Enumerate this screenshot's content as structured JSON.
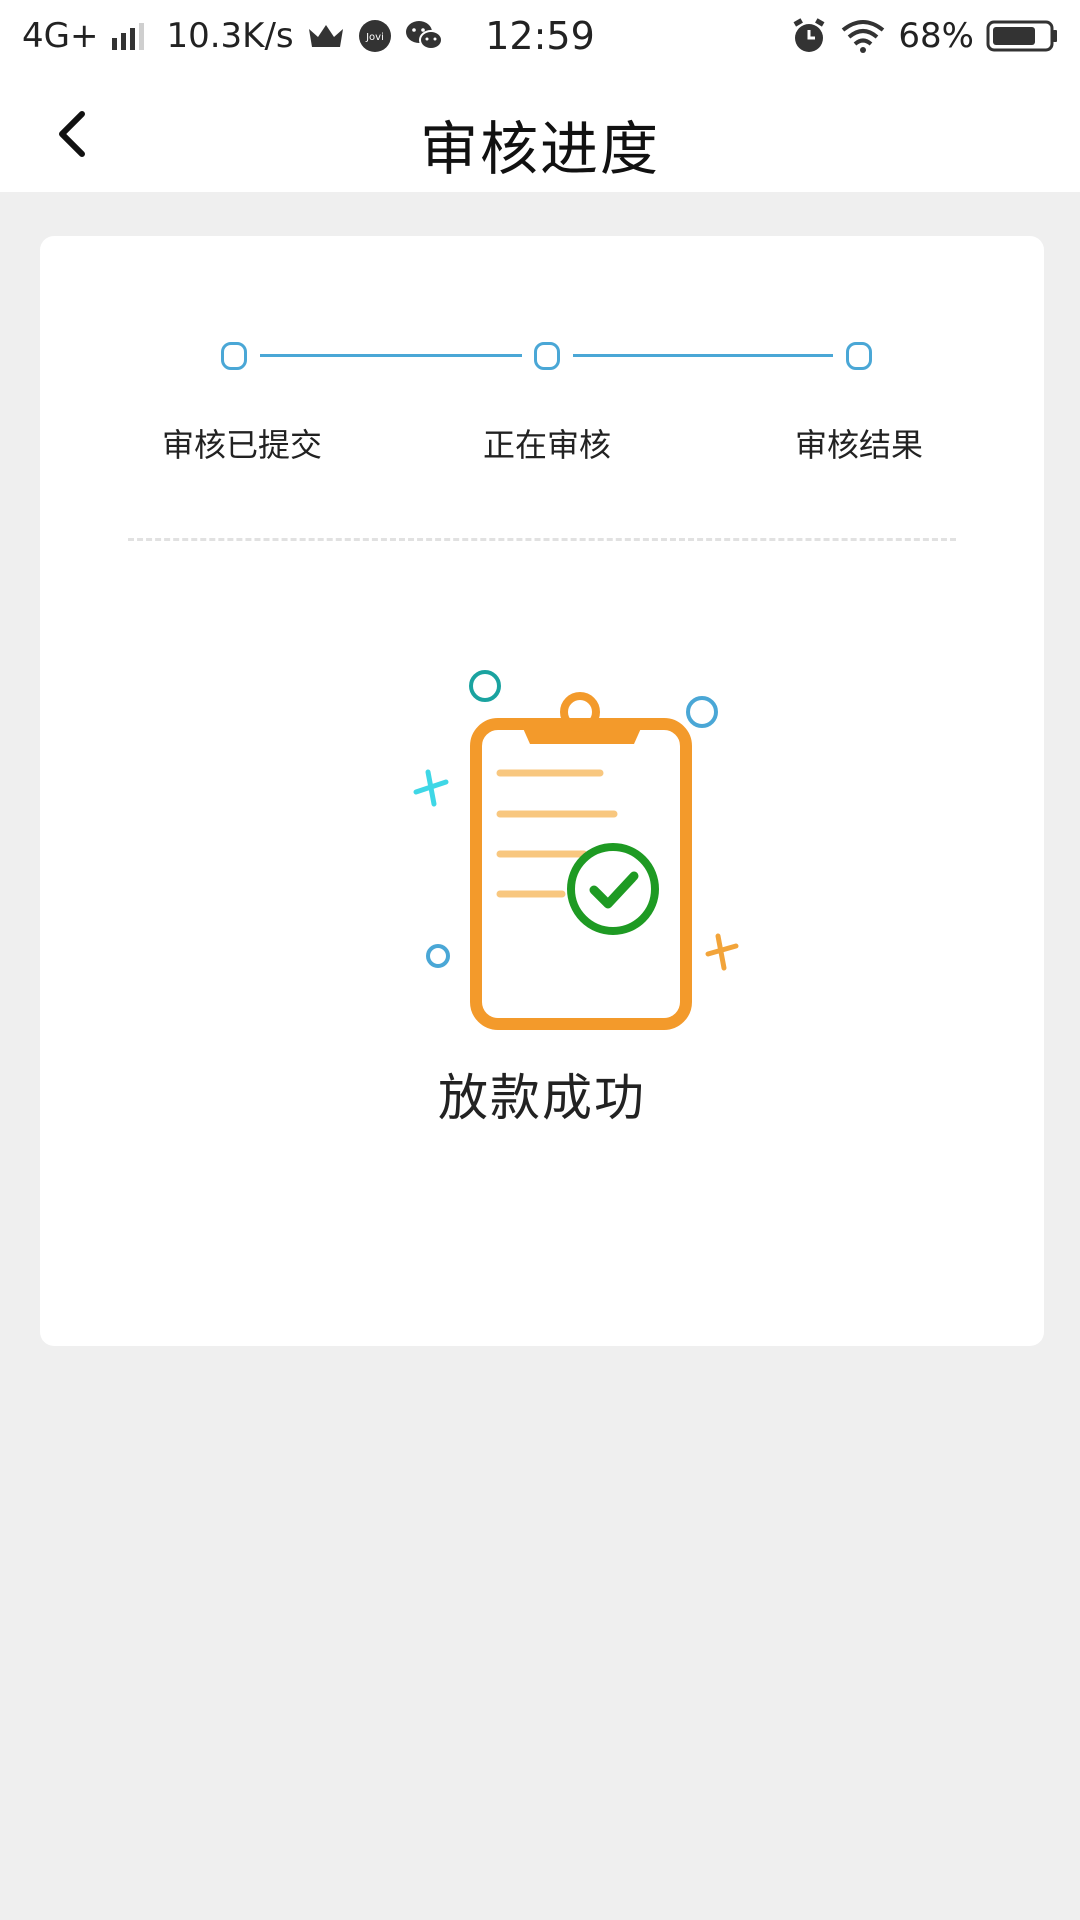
{
  "status_bar": {
    "network": "4G+",
    "speed": "10.3K/s",
    "time": "12:59",
    "battery": "68%",
    "icons": [
      "signal-icon",
      "crown-icon",
      "jovi-icon",
      "wechat-icon",
      "alarm-icon",
      "wifi-icon",
      "battery-icon"
    ],
    "jovi_label": "Jovi"
  },
  "header": {
    "title": "审核进度",
    "back_icon": "chevron-left-icon"
  },
  "progress": {
    "steps": [
      {
        "label": "审核已提交"
      },
      {
        "label": "正在审核"
      },
      {
        "label": "审核结果"
      }
    ],
    "accent": "#4aa7d6"
  },
  "result": {
    "text": "放款成功",
    "icon": "clipboard-check-icon",
    "colors": {
      "clipboard": "#f39a2b",
      "check": "#1e9a23",
      "lines": "#f8c77f"
    }
  }
}
